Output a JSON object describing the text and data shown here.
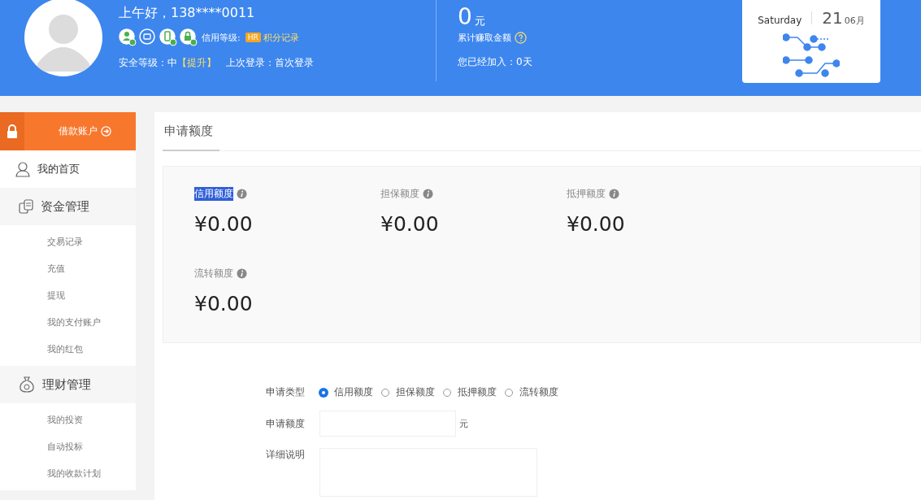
{
  "header": {
    "greeting": "上午好，138****0011",
    "badges": [
      {
        "kind": "user",
        "verified": true
      },
      {
        "kind": "mail",
        "verified": false
      },
      {
        "kind": "phone",
        "verified": true
      },
      {
        "kind": "lock",
        "verified": true
      }
    ],
    "credit_label": "信用等级:",
    "credit_grade": "HR",
    "points_link": "积分记录",
    "security_label": "安全等级：中",
    "security_upgrade": "【提升】",
    "last_login": "上次登录：首次登录",
    "earned_amount": "0",
    "earned_unit": "元",
    "earned_label": "累计赚取金额",
    "joined": "您已经加入：0天",
    "date": {
      "weekday": "Saturday",
      "day": "21",
      "month": "06月"
    }
  },
  "sidebar": {
    "account_button": "借款账户",
    "items": [
      {
        "kind": "link",
        "label": "我的首页"
      },
      {
        "kind": "group",
        "label": "资金管理",
        "children": [
          {
            "label": "交易记录"
          },
          {
            "label": "充值"
          },
          {
            "label": "提现"
          },
          {
            "label": "我的支付账户"
          },
          {
            "label": "我的红包"
          }
        ]
      },
      {
        "kind": "group",
        "label": "理财管理",
        "children": [
          {
            "label": "我的投资"
          },
          {
            "label": "自动投标"
          },
          {
            "label": "我的收款计划"
          }
        ]
      }
    ]
  },
  "tabs": [
    {
      "label": "申请额度",
      "selected": true
    }
  ],
  "quotas": [
    {
      "label": "信用额度",
      "value": "¥0.00",
      "text_selected": true
    },
    {
      "label": "担保额度",
      "value": "¥0.00",
      "text_selected": false
    },
    {
      "label": "抵押额度",
      "value": "¥0.00",
      "text_selected": false
    },
    {
      "label": "流转额度",
      "value": "¥0.00",
      "text_selected": false
    }
  ],
  "form": {
    "type_label": "申请类型",
    "types": [
      {
        "label": "信用额度",
        "selected": true
      },
      {
        "label": "担保额度",
        "selected": false
      },
      {
        "label": "抵押额度",
        "selected": false
      },
      {
        "label": "流转额度",
        "selected": false
      }
    ],
    "amount_label": "申请额度",
    "amount_unit": "元",
    "detail_label": "详细说明"
  }
}
